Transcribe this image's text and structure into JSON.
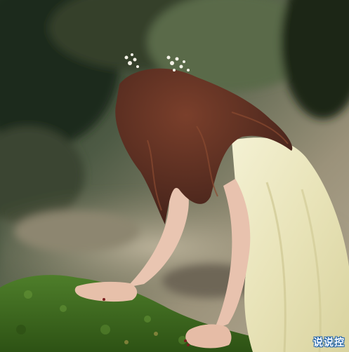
{
  "photo": {
    "subject": "girl",
    "colors": {
      "forest_dark": "#2e3a2c",
      "ground": "#a59a82",
      "moss": "#3f6b22",
      "hair": "#5a2f22",
      "dress": "#ede9c4",
      "skin": "#e8c2ae"
    }
  },
  "watermark": {
    "text": "说说控"
  }
}
